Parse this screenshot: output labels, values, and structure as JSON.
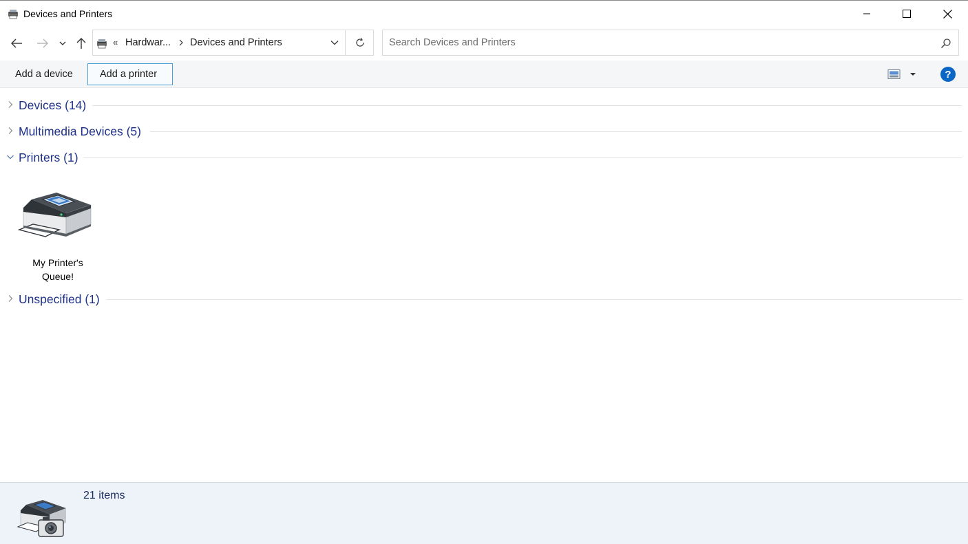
{
  "window": {
    "title": "Devices and Printers"
  },
  "address": {
    "overflow": "«",
    "crumbs": [
      "Hardwar...",
      "Devices and Printers"
    ]
  },
  "search": {
    "placeholder": "Search Devices and Printers",
    "value": ""
  },
  "commands": {
    "add_device": "Add a device",
    "add_printer": "Add a printer",
    "help": "?"
  },
  "groups": [
    {
      "label": "Devices",
      "count": "(14)",
      "expanded": false
    },
    {
      "label": "Multimedia Devices",
      "count": "(5)",
      "expanded": false
    },
    {
      "label": "Printers",
      "count": "(1)",
      "expanded": true
    },
    {
      "label": "Unspecified",
      "count": "(1)",
      "expanded": false
    }
  ],
  "printer_item": {
    "line1": "My Printer's",
    "line2": "Queue!",
    "icon": "printer-icon"
  },
  "details_pane": {
    "item_count": "21 items",
    "icon": "devices-printers-icon"
  },
  "colors": {
    "group_label": "#1e3287",
    "focus_border": "#4d9ed8",
    "help_blue": "#0c66c5",
    "details_bg": "#eef3fa"
  }
}
